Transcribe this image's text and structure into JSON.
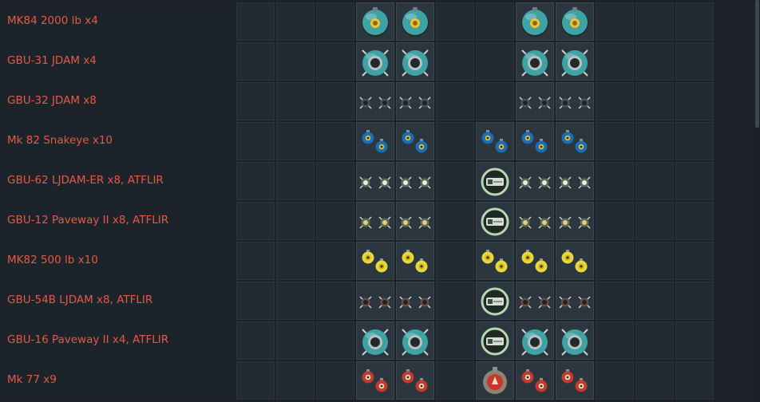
{
  "presets": [
    {
      "label": "MK84 2000 lb x4",
      "slots": [
        "",
        "",
        "",
        "mk84",
        "mk84",
        "",
        "",
        "mk84",
        "mk84",
        "",
        "",
        ""
      ]
    },
    {
      "label": "GBU-31 JDAM x4",
      "slots": [
        "",
        "",
        "",
        "gbu31",
        "gbu31",
        "",
        "",
        "gbu31",
        "gbu31",
        "",
        "",
        ""
      ]
    },
    {
      "label": "GBU-32 JDAM x8",
      "slots": [
        "",
        "",
        "",
        "gbu32",
        "gbu32",
        "",
        "",
        "gbu32",
        "gbu32",
        "",
        "",
        ""
      ]
    },
    {
      "label": "Mk 82 Snakeye x10",
      "slots": [
        "",
        "",
        "",
        "snakeye",
        "snakeye",
        "",
        "snakeye",
        "snakeye",
        "snakeye",
        "",
        "",
        ""
      ]
    },
    {
      "label": "GBU-62 LJDAM-ER x8,  ATFLIR",
      "slots": [
        "",
        "",
        "",
        "gbu62",
        "gbu62",
        "",
        "atflir",
        "gbu62",
        "gbu62",
        "",
        "",
        ""
      ]
    },
    {
      "label": "GBU-12 Paveway II x8,  ATFLIR",
      "slots": [
        "",
        "",
        "",
        "gbu12",
        "gbu12",
        "",
        "atflir",
        "gbu12",
        "gbu12",
        "",
        "",
        ""
      ]
    },
    {
      "label": "MK82 500 lb x10",
      "slots": [
        "",
        "",
        "",
        "mk82",
        "mk82",
        "",
        "mk82",
        "mk82",
        "mk82",
        "",
        "",
        ""
      ]
    },
    {
      "label": "GBU-54B LJDAM x8,  ATFLIR",
      "slots": [
        "",
        "",
        "",
        "gbu54",
        "gbu54",
        "",
        "atflir",
        "gbu54",
        "gbu54",
        "",
        "",
        ""
      ]
    },
    {
      "label": "GBU-16 Paveway II x4,  ATFLIR",
      "slots": [
        "",
        "",
        "",
        "gbu16",
        "gbu16",
        "",
        "atflir",
        "gbu16",
        "gbu16",
        "",
        "",
        ""
      ]
    },
    {
      "label": "Mk 77 x9",
      "slots": [
        "",
        "",
        "",
        "mk77",
        "mk77",
        "",
        "mk77big",
        "mk77",
        "mk77",
        "",
        "",
        ""
      ]
    }
  ],
  "icons": {
    "mk84": "mk84-bomb-icon",
    "gbu31": "gbu31-jdam-icon",
    "gbu32": "gbu32-jdam-pair-icon",
    "snakeye": "mk82-snakeye-pair-icon",
    "gbu62": "gbu62-ljdam-pair-icon",
    "gbu12": "gbu12-paveway-pair-icon",
    "mk82": "mk82-bomb-pair-icon",
    "gbu54": "gbu54-ljdam-pair-icon",
    "gbu16": "gbu16-paveway-icon",
    "mk77": "mk77-incendiary-pair-icon",
    "mk77big": "mk77-incendiary-icon",
    "atflir": "atflir-pod-icon"
  },
  "colors": {
    "label_text": "#e35a44",
    "mk84_body": "#3fa2a4",
    "mk84_center": "#f2c232",
    "snakeye_ring": "#1a6db5",
    "snakeye_core": "#d8c23a",
    "mk82_body": "#e5d83a",
    "mk77_body": "#c23a2a",
    "atflir_ring": "#b9d6b3"
  }
}
